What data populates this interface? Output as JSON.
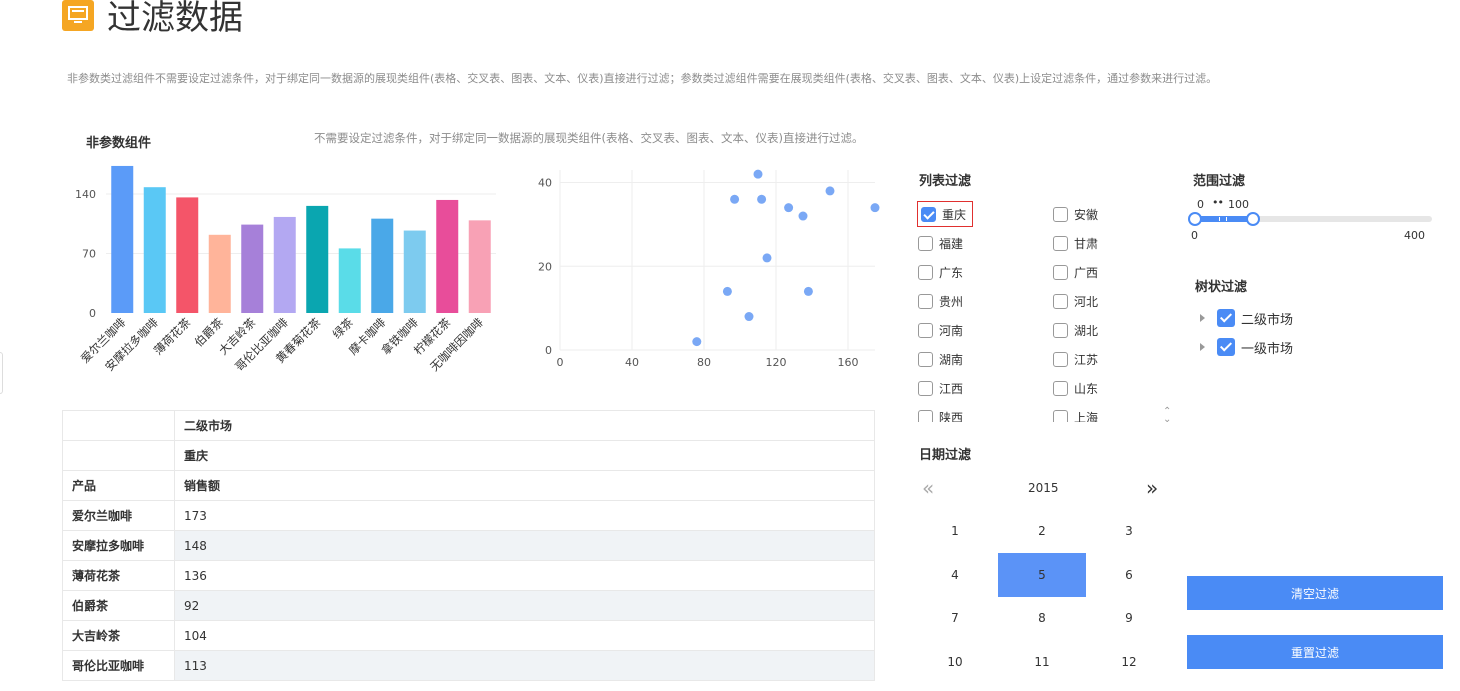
{
  "header": {
    "icon": "monitor-icon",
    "title": "过滤数据",
    "intro": "非参数类过滤组件不需要设定过滤条件，对于绑定同一数据源的展现类组件(表格、交叉表、图表、文本、仪表)直接进行过滤；参数类过滤组件需要在展现类组件(表格、交叉表、图表、文本、仪表)上设定过滤条件，通过参数来进行过滤。"
  },
  "nonparam": {
    "title": "非参数组件",
    "desc": "不需要设定过滤条件，对于绑定同一数据源的展现类组件(表格、交叉表、图表、文本、仪表)直接进行过滤。"
  },
  "chart_data": [
    {
      "type": "bar",
      "categories": [
        "爱尔兰咖啡",
        "安摩拉多咖啡",
        "薄荷花茶",
        "伯爵茶",
        "大吉岭茶",
        "哥伦比亚咖啡",
        "黄春菊花茶",
        "绿茶",
        "摩卡咖啡",
        "拿铁咖啡",
        "柠檬花茶",
        "无咖啡因咖啡"
      ],
      "values": [
        173,
        148,
        136,
        92,
        104,
        113,
        126,
        76,
        111,
        97,
        133,
        109
      ],
      "colors": [
        "#5b9bf8",
        "#5ac8f5",
        "#f45569",
        "#ffb49a",
        "#a680d9",
        "#b3a8f2",
        "#0aa6b0",
        "#5adce8",
        "#4aa8e8",
        "#7dcbef",
        "#e84d9a",
        "#f8a1b5"
      ],
      "yticks": [
        0,
        70,
        140
      ],
      "ylim": [
        0,
        180
      ]
    },
    {
      "type": "scatter",
      "points": [
        [
          110,
          42
        ],
        [
          97,
          36
        ],
        [
          112,
          36
        ],
        [
          150,
          38
        ],
        [
          127,
          34
        ],
        [
          135,
          32
        ],
        [
          175,
          34
        ],
        [
          115,
          22
        ],
        [
          93,
          14
        ],
        [
          138,
          14
        ],
        [
          105,
          8
        ],
        [
          76,
          2
        ]
      ],
      "xticks": [
        0,
        40,
        80,
        120,
        160
      ],
      "yticks": [
        0,
        20,
        40
      ],
      "xlim": [
        0,
        175
      ],
      "ylim": [
        0,
        43
      ],
      "color": "#7aa8f5"
    }
  ],
  "table": {
    "market": "二级市场",
    "region": "重庆",
    "col_product": "产品",
    "col_sales": "销售额",
    "rows": [
      {
        "product": "爱尔兰咖啡",
        "sales": "173"
      },
      {
        "product": "安摩拉多咖啡",
        "sales": "148"
      },
      {
        "product": "薄荷花茶",
        "sales": "136"
      },
      {
        "product": "伯爵茶",
        "sales": "92"
      },
      {
        "product": "大吉岭茶",
        "sales": "104"
      },
      {
        "product": "哥伦比亚咖啡",
        "sales": "113"
      }
    ]
  },
  "list_filter": {
    "title": "列表过滤",
    "items": [
      {
        "label": "重庆",
        "checked": true
      },
      {
        "label": "安徽",
        "checked": false
      },
      {
        "label": "福建",
        "checked": false
      },
      {
        "label": "甘肃",
        "checked": false
      },
      {
        "label": "广东",
        "checked": false
      },
      {
        "label": "广西",
        "checked": false
      },
      {
        "label": "贵州",
        "checked": false
      },
      {
        "label": "河北",
        "checked": false
      },
      {
        "label": "河南",
        "checked": false
      },
      {
        "label": "湖北",
        "checked": false
      },
      {
        "label": "湖南",
        "checked": false
      },
      {
        "label": "江苏",
        "checked": false
      },
      {
        "label": "江西",
        "checked": false
      },
      {
        "label": "山东",
        "checked": false
      },
      {
        "label": "陕西",
        "checked": false
      },
      {
        "label": "上海",
        "checked": false
      }
    ]
  },
  "range_filter": {
    "title": "范围过滤",
    "low": "0",
    "high": "100",
    "min": "0",
    "max": "400",
    "dots": "••"
  },
  "tree_filter": {
    "title": "树状过滤",
    "items": [
      {
        "label": "二级市场",
        "checked": true
      },
      {
        "label": "一级市场",
        "checked": true
      }
    ]
  },
  "date_filter": {
    "title": "日期过滤",
    "prev": "«",
    "next": "»",
    "year": "2015",
    "months": [
      "1",
      "2",
      "3",
      "4",
      "5",
      "6",
      "7",
      "8",
      "9",
      "10",
      "11",
      "12"
    ],
    "selected": "5"
  },
  "buttons": {
    "clear": "清空过滤",
    "reset": "重置过滤"
  }
}
